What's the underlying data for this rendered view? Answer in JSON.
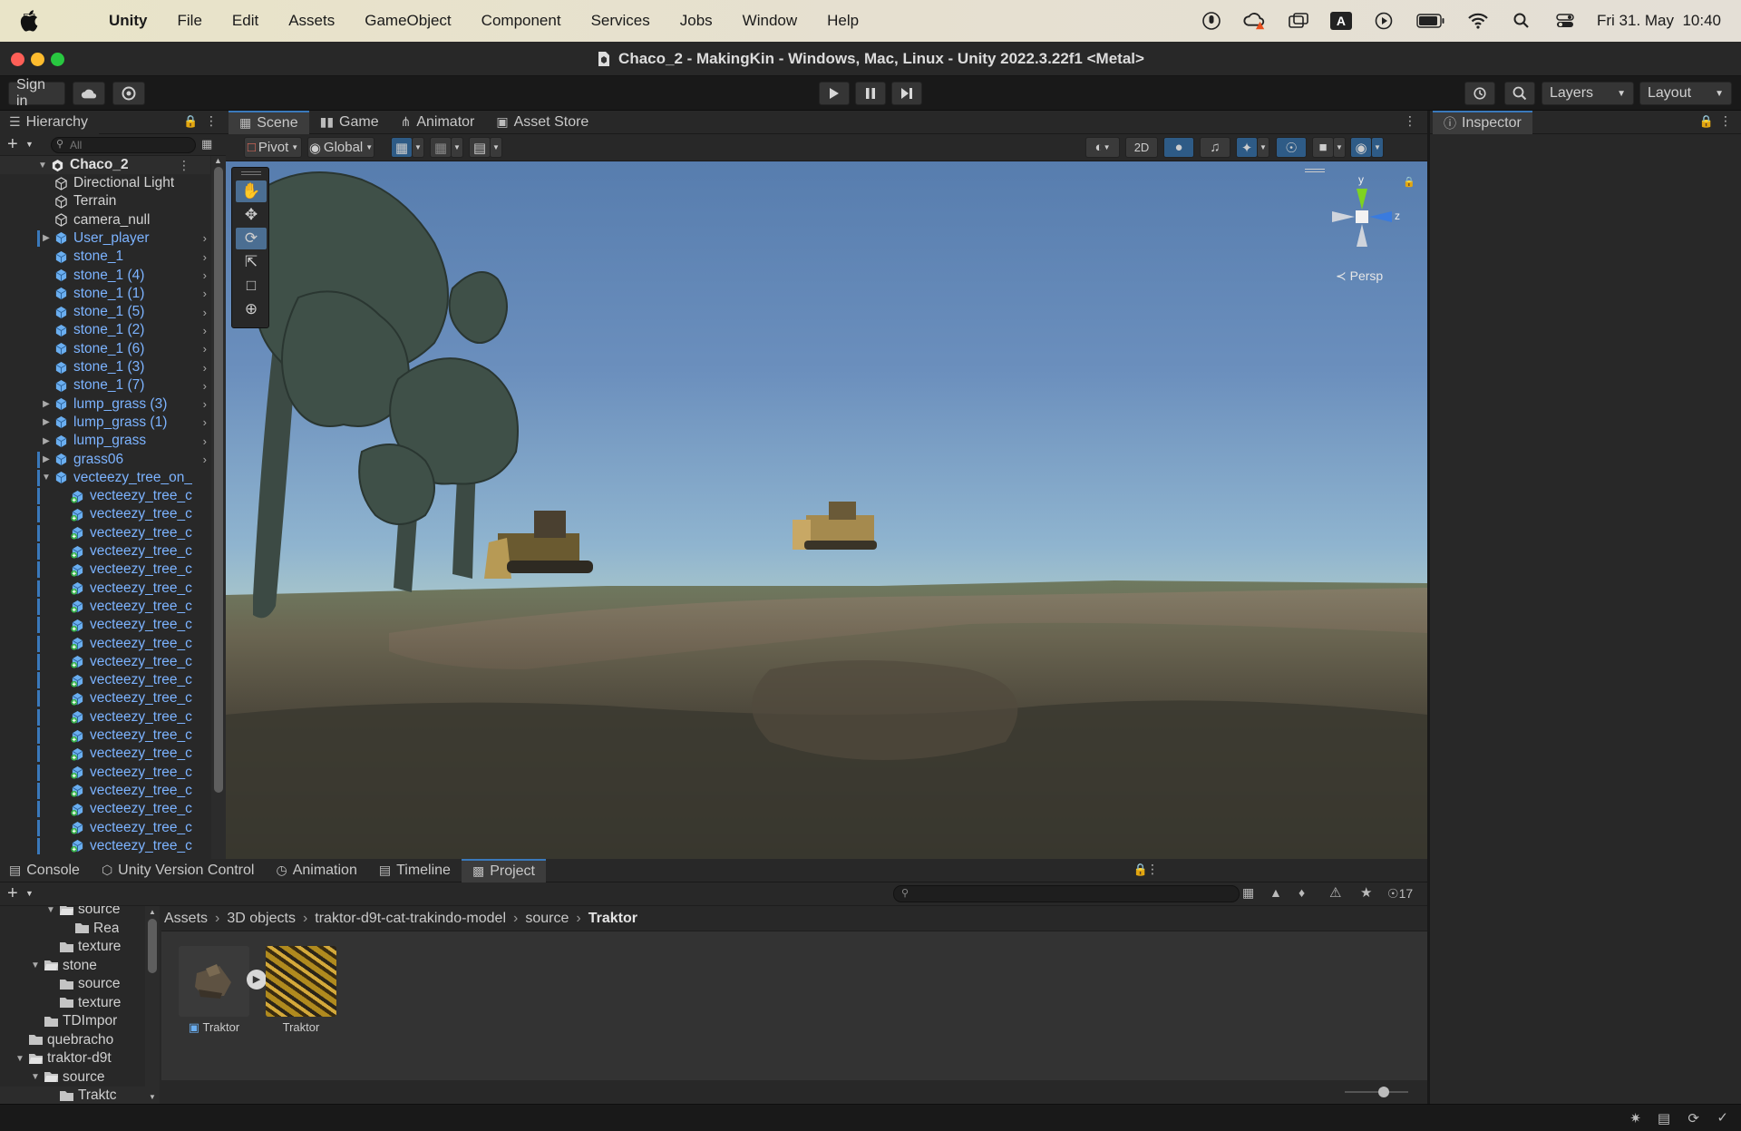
{
  "menubar": {
    "app_name": "Unity",
    "items": [
      "File",
      "Edit",
      "Assets",
      "GameObject",
      "Component",
      "Services",
      "Jobs",
      "Window",
      "Help"
    ],
    "status_icons": [
      "microphone-icon",
      "creative-cloud-icon",
      "screen-mirror-icon",
      "input-source-icon",
      "play-circle-icon",
      "battery-icon",
      "wifi-icon",
      "spotlight-icon",
      "control-center-icon"
    ],
    "input_source": "A",
    "datetime": "Fri 31. May  10:40"
  },
  "window": {
    "title": "Chaco_2 - MakingKin - Windows, Mac, Linux - Unity 2022.3.22f1 <Metal>"
  },
  "toolbar": {
    "sign_in": "Sign in",
    "layers": "Layers",
    "layout": "Layout"
  },
  "hierarchy": {
    "tab": "Hierarchy",
    "search_placeholder": "All",
    "scene_name": "Chaco_2",
    "items": [
      {
        "label": "Directional Light",
        "type": "object",
        "indent": 1
      },
      {
        "label": "Terrain",
        "type": "object",
        "indent": 1
      },
      {
        "label": "camera_null",
        "type": "object",
        "indent": 1
      },
      {
        "label": "User_player",
        "type": "prefab",
        "indent": 1,
        "foldout": "collapsed",
        "chevron": true,
        "mark": true
      },
      {
        "label": "stone_1",
        "type": "prefab",
        "indent": 1,
        "chevron": true
      },
      {
        "label": "stone_1 (4)",
        "type": "prefab",
        "indent": 1,
        "chevron": true
      },
      {
        "label": "stone_1 (1)",
        "type": "prefab",
        "indent": 1,
        "chevron": true
      },
      {
        "label": "stone_1 (5)",
        "type": "prefab",
        "indent": 1,
        "chevron": true
      },
      {
        "label": "stone_1 (2)",
        "type": "prefab",
        "indent": 1,
        "chevron": true
      },
      {
        "label": "stone_1 (6)",
        "type": "prefab",
        "indent": 1,
        "chevron": true
      },
      {
        "label": "stone_1 (3)",
        "type": "prefab",
        "indent": 1,
        "chevron": true
      },
      {
        "label": "stone_1 (7)",
        "type": "prefab",
        "indent": 1,
        "chevron": true
      },
      {
        "label": "lump_grass (3)",
        "type": "prefab",
        "indent": 1,
        "foldout": "collapsed",
        "chevron": true
      },
      {
        "label": "lump_grass (1)",
        "type": "prefab",
        "indent": 1,
        "foldout": "collapsed",
        "chevron": true
      },
      {
        "label": "lump_grass",
        "type": "prefab",
        "indent": 1,
        "foldout": "collapsed",
        "chevron": true
      },
      {
        "label": "grass06",
        "type": "prefab",
        "indent": 1,
        "foldout": "collapsed",
        "chevron": true,
        "mark": true
      },
      {
        "label": "vecteezy_tree_on_",
        "type": "prefab",
        "indent": 1,
        "foldout": "expanded",
        "mark": true
      },
      {
        "label": "vecteezy_tree_c",
        "type": "prefab-added",
        "indent": 2,
        "mark": true
      },
      {
        "label": "vecteezy_tree_c",
        "type": "prefab-added",
        "indent": 2,
        "mark": true
      },
      {
        "label": "vecteezy_tree_c",
        "type": "prefab-added",
        "indent": 2,
        "mark": true
      },
      {
        "label": "vecteezy_tree_c",
        "type": "prefab-added",
        "indent": 2,
        "mark": true
      },
      {
        "label": "vecteezy_tree_c",
        "type": "prefab-added",
        "indent": 2,
        "mark": true
      },
      {
        "label": "vecteezy_tree_c",
        "type": "prefab-added",
        "indent": 2,
        "mark": true
      },
      {
        "label": "vecteezy_tree_c",
        "type": "prefab-added",
        "indent": 2,
        "mark": true
      },
      {
        "label": "vecteezy_tree_c",
        "type": "prefab-added",
        "indent": 2,
        "mark": true
      },
      {
        "label": "vecteezy_tree_c",
        "type": "prefab-added",
        "indent": 2,
        "mark": true
      },
      {
        "label": "vecteezy_tree_c",
        "type": "prefab-added",
        "indent": 2,
        "mark": true
      },
      {
        "label": "vecteezy_tree_c",
        "type": "prefab-added",
        "indent": 2,
        "mark": true
      },
      {
        "label": "vecteezy_tree_c",
        "type": "prefab-added",
        "indent": 2,
        "mark": true
      },
      {
        "label": "vecteezy_tree_c",
        "type": "prefab-added",
        "indent": 2,
        "mark": true
      },
      {
        "label": "vecteezy_tree_c",
        "type": "prefab-added",
        "indent": 2,
        "mark": true
      },
      {
        "label": "vecteezy_tree_c",
        "type": "prefab-added",
        "indent": 2,
        "mark": true
      },
      {
        "label": "vecteezy_tree_c",
        "type": "prefab-added",
        "indent": 2,
        "mark": true
      },
      {
        "label": "vecteezy_tree_c",
        "type": "prefab-added",
        "indent": 2,
        "mark": true
      },
      {
        "label": "vecteezy_tree_c",
        "type": "prefab-added",
        "indent": 2,
        "mark": true
      },
      {
        "label": "vecteezy_tree_c",
        "type": "prefab-added",
        "indent": 2,
        "mark": true
      },
      {
        "label": "vecteezy_tree_c",
        "type": "prefab-added",
        "indent": 2,
        "mark": true
      }
    ]
  },
  "scene": {
    "tabs": [
      "Scene",
      "Game",
      "Animator",
      "Asset Store"
    ],
    "pivot": "Pivot",
    "global": "Global",
    "mode_2d": "2D",
    "persp_label": "Persp",
    "axis_y": "y",
    "axis_z": "z"
  },
  "inspector": {
    "tab": "Inspector"
  },
  "bottom": {
    "tabs": [
      "Console",
      "Unity Version Control",
      "Animation",
      "Timeline",
      "Project"
    ],
    "hidden_count": "17",
    "breadcrumb": [
      "Assets",
      "3D objects",
      "traktor-d9t-cat-trakindo-model",
      "source",
      "Traktor"
    ],
    "tree": [
      {
        "label": "source",
        "indent": 4,
        "foldout": "expanded",
        "open": true
      },
      {
        "label": "Rea",
        "indent": 5
      },
      {
        "label": "texture",
        "indent": 4
      },
      {
        "label": "stone",
        "indent": 3,
        "foldout": "expanded",
        "open": true
      },
      {
        "label": "source",
        "indent": 4
      },
      {
        "label": "texture",
        "indent": 4
      },
      {
        "label": "TDImpor",
        "indent": 3
      },
      {
        "label": "quebracho",
        "indent": 2
      },
      {
        "label": "traktor-d9t",
        "indent": 2,
        "foldout": "expanded",
        "open": true
      },
      {
        "label": "source",
        "indent": 3,
        "foldout": "expanded",
        "open": true
      },
      {
        "label": "Traktc",
        "indent": 4,
        "selected": true
      }
    ],
    "assets": [
      {
        "name": "Traktor",
        "kind": "model"
      },
      {
        "name": "Traktor",
        "kind": "texture"
      }
    ]
  }
}
